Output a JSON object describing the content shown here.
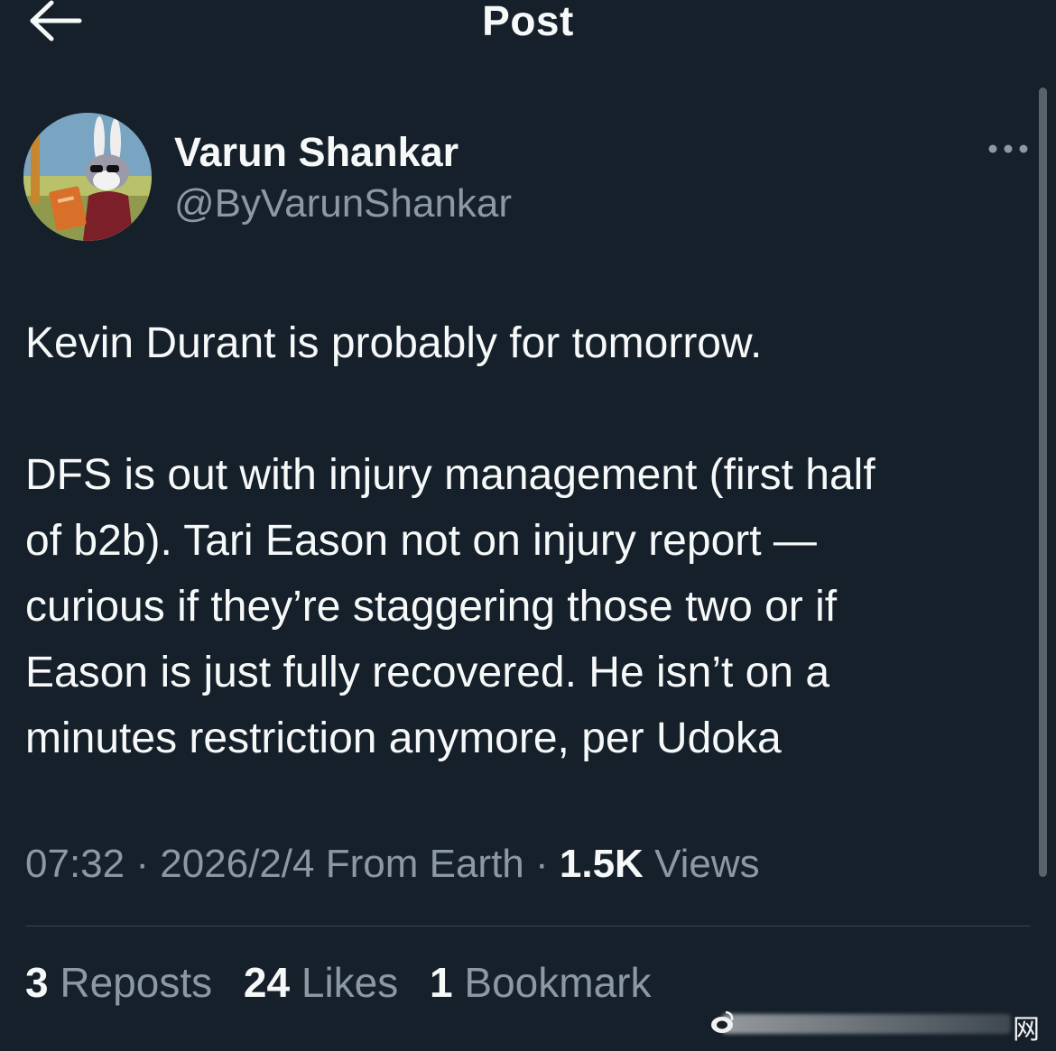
{
  "header": {
    "title": "Post",
    "back_icon": "arrow-left-icon"
  },
  "author": {
    "name": "Varun Shankar",
    "handle": "@ByVarunShankar",
    "avatar": "cartoon-rabbit-avatar"
  },
  "more_icon": "more-horizontal-icon",
  "tweet": {
    "line1": "Kevin Durant is probably for tomorrow.",
    "lines": [
      "DFS is out with injury management (first half",
      "of b2b). Tari Eason not on injury report —",
      "curious if they’re staggering those two or if",
      "Eason is just fully recovered. He isn’t on a",
      "minutes restriction anymore, per Udoka"
    ]
  },
  "meta": {
    "time": "07:32",
    "separator": " · ",
    "date": "2026/2/4",
    "location": "From Earth",
    "views_count": "1.5K",
    "views_label": "Views"
  },
  "stats": {
    "reposts_count": "3",
    "reposts_label": "Reposts",
    "likes_count": "24",
    "likes_label": "Likes",
    "bookmarks_count": "1",
    "bookmarks_label": "Bookmark"
  },
  "watermark": {
    "text": "网"
  },
  "colors": {
    "background": "#15202b",
    "text_primary": "#f7f9f9",
    "text_secondary": "#8b98a5",
    "divider": "#38444d"
  }
}
